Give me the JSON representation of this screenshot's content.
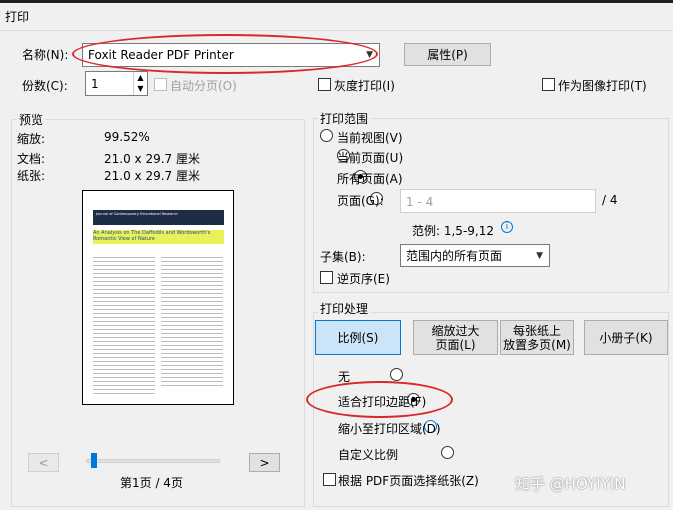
{
  "window": {
    "title": "打印"
  },
  "printer": {
    "name_label": "名称(N):",
    "name_value": "Foxit Reader PDF Printer",
    "properties_button": "属性(P)",
    "copies_label": "份数(C):",
    "copies_value": "1",
    "collate_label": "自动分页(O)",
    "grayscale_label": "灰度打印(I)",
    "print_as_image_label": "作为图像打印(T)"
  },
  "preview": {
    "group_label": "预览",
    "zoom_label": "缩放:",
    "zoom_value": "99.52%",
    "doc_label": "文档:",
    "doc_value": "21.0 x 29.7 厘米",
    "paper_label": "纸张:",
    "paper_value": "21.0 x 29.7 厘米",
    "prev_button": "<",
    "next_button": ">",
    "page_indicator": "第1页 / 4页",
    "slider_fraction": 0.04,
    "thumb": {
      "journal": "Journal of Contemporary Educational Research",
      "article_title": "An Analysis on The Daffodils and Wordsworth's Romantic View of Nature"
    }
  },
  "range": {
    "group_label": "打印范围",
    "current_view": "当前视图(V)",
    "current_page": "当前页面(U)",
    "all_pages": "所有页面(A)",
    "pages_label": "页面(G):",
    "pages_placeholder": "1 - 4",
    "total_pages": "/ 4",
    "example": "范例: 1,5-9,12",
    "subset_label": "子集(B):",
    "subset_value": "范围内的所有页面",
    "reverse_label": "逆页序(E)"
  },
  "handling": {
    "group_label": "打印处理",
    "scale_button": "比例(S)",
    "fit_button_line1": "缩放过大",
    "fit_button_line2": "页面(L)",
    "multi_button_line1": "每张纸上",
    "multi_button_line2": "放置多页(M)",
    "booklet_button": "小册子(K)",
    "none_label": "无",
    "fit_margin_label": "适合打印边距(F)",
    "shrink_label": "缩小至打印区域(D)",
    "custom_label": "自定义比例",
    "pdf_paper_label": "根据 PDF页面选择纸张(Z)"
  },
  "watermark": "知乎 @HOYIYIN",
  "colors": {
    "annotation_red": "#d8282a",
    "accent": "#0078d7"
  }
}
